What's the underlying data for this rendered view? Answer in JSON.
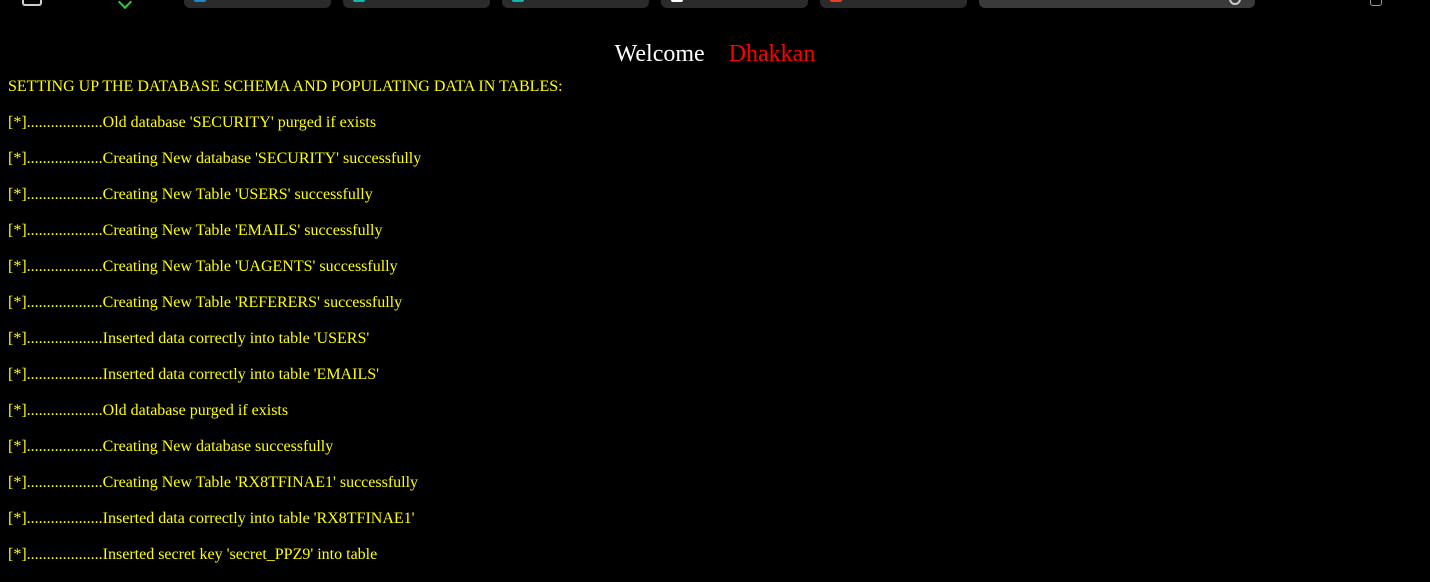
{
  "browser": {
    "tab_colors": [
      "#1e88c8",
      "#10b8a8",
      "#10b8a8",
      "#ffffff",
      "#e8401c"
    ]
  },
  "header": {
    "welcome_word": "Welcome",
    "user_name": "Dhakkan"
  },
  "log": {
    "heading": "SETTING UP THE DATABASE SCHEMA AND POPULATING DATA IN TABLES:",
    "lines": [
      "[*]...................Old database 'SECURITY' purged if exists",
      "[*]...................Creating New database 'SECURITY' successfully",
      "[*]...................Creating New Table 'USERS' successfully",
      "[*]...................Creating New Table 'EMAILS' successfully",
      "[*]...................Creating New Table 'UAGENTS' successfully",
      "[*]...................Creating New Table 'REFERERS' successfully",
      "[*]...................Inserted data correctly into table 'USERS'",
      "[*]...................Inserted data correctly into table 'EMAILS'",
      "[*]...................Old database purged if exists",
      "[*]...................Creating New database successfully",
      "[*]...................Creating New Table 'RX8TFINAE1' successfully",
      "[*]...................Inserted data correctly into table 'RX8TFINAE1'",
      "[*]...................Inserted secret key 'secret_PPZ9' into table"
    ]
  },
  "colors": {
    "background": "#000000",
    "log_text": "#ffff00",
    "welcome_text": "#ffffff",
    "user_name": "#ff0000"
  }
}
